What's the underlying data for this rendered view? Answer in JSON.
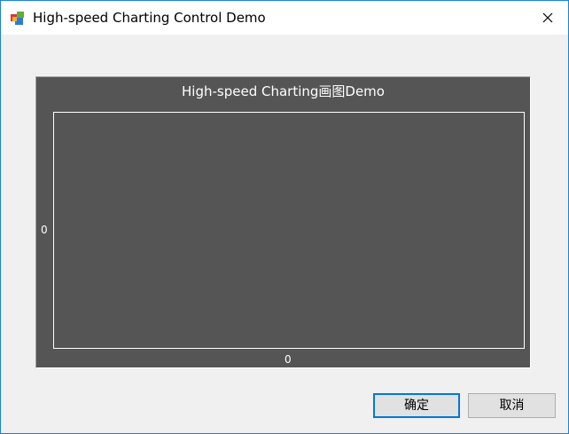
{
  "window": {
    "title": "High-speed Charting Control Demo",
    "icons": {
      "app": "app-window-icon",
      "close": "close-icon"
    }
  },
  "chart": {
    "title": "High-speed Charting画图Demo"
  },
  "chart_data": {
    "type": "line",
    "title": "High-speed Charting画图Demo",
    "xlabel": "",
    "ylabel": "",
    "x_tick_labels": [
      "0"
    ],
    "y_tick_labels": [
      "0"
    ],
    "series": [],
    "background_color": "#555555",
    "axis_color": "#ffffff",
    "grid": false
  },
  "buttons": {
    "ok": "确定",
    "cancel": "取消"
  }
}
